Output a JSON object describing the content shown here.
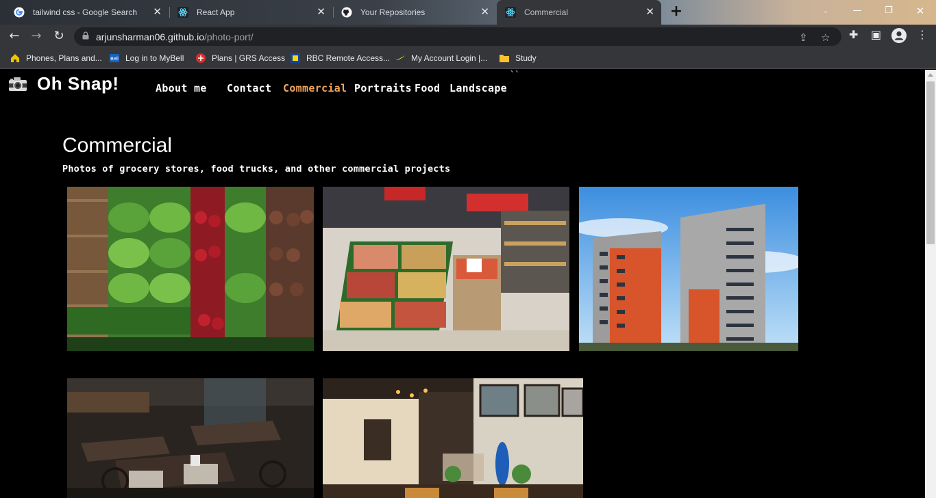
{
  "browser": {
    "tabs": [
      {
        "title": "tailwind css - Google Search",
        "icon": "google-icon"
      },
      {
        "title": "React App",
        "icon": "react-icon"
      },
      {
        "title": "Your Repositories",
        "icon": "github-icon"
      },
      {
        "title": "Commercial",
        "icon": "react-icon",
        "active": true
      }
    ],
    "address": {
      "host": "arjunsharman06.github.io",
      "path": "/photo-port/"
    },
    "bookmarks": [
      {
        "label": "Phones, Plans and...",
        "icon": "bookmark-house-icon"
      },
      {
        "label": "Log in to MyBell",
        "icon": "bell-icon"
      },
      {
        "label": "Plans | GRS Access",
        "icon": "life-icon"
      },
      {
        "label": "RBC Remote Access...",
        "icon": "rbc-icon"
      },
      {
        "label": "My Account Login |...",
        "icon": "swoosh-icon"
      },
      {
        "label": "Study",
        "icon": "folder-icon"
      }
    ]
  },
  "site": {
    "brand": "Oh Snap!",
    "nav": [
      {
        "label": "About me",
        "active": false
      },
      {
        "label": "Contact",
        "active": false
      },
      {
        "label": "Commercial",
        "active": true
      },
      {
        "label": "Portraits",
        "active": false
      },
      {
        "label": "Food",
        "active": false
      },
      {
        "label": "Landscape",
        "active": false
      }
    ],
    "stray_text": "``",
    "section": {
      "title": "Commercial",
      "description": "Photos of grocery stores, food trucks, and other commercial projects"
    },
    "photos": [
      {
        "subject": "grocery-produce-shelves"
      },
      {
        "subject": "grocery-store-aisle"
      },
      {
        "subject": "apartment-buildings"
      },
      {
        "subject": "restaurant-dining-room"
      },
      {
        "subject": "cafe-interior"
      }
    ]
  },
  "colors": {
    "accent": "#f0a45d",
    "page_bg": "#000000",
    "chrome_bg": "#35363a"
  }
}
